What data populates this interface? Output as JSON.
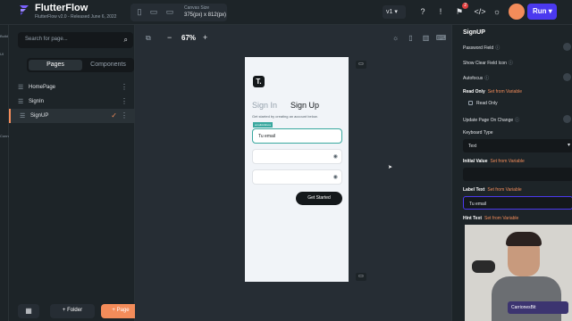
{
  "topbar": {
    "app_name": "FlutterFlow",
    "app_version": "FlutterFlow v2.0 - Released June 6, 2022",
    "canvas_size_label": "Canvas Size",
    "canvas_size_value": "375(px) x 812(px)",
    "version": "v1",
    "notification_count": "2",
    "run_label": "Run"
  },
  "rail": {
    "labels": [
      "Build",
      "UI",
      "Connect"
    ]
  },
  "pages_panel": {
    "search_placeholder": "Search for page...",
    "tabs": [
      "Pages",
      "Components"
    ],
    "pages": [
      "HomePage",
      "SignIn",
      "SignUP"
    ],
    "folder_label": "Folder",
    "page_label": "Page"
  },
  "canvas": {
    "zoom": "67%"
  },
  "phone": {
    "logo_letter": "T.",
    "tab_signin": "Sign In",
    "tab_signup": "Sign Up",
    "subtitle": "Get started by creating an account below.",
    "selected_tag": "emailAddress",
    "email_text": "Tu email",
    "button": "Get Started"
  },
  "properties": {
    "title": "SignUP",
    "password_field": "Password Field",
    "show_clear": "Show Clear Field Icon",
    "autofocus": "Autofocus",
    "read_only": "Read Only",
    "set_from_variable": "Set from Variable",
    "read_only_checkbox": "Read Only",
    "update_page": "Update Page On Change",
    "keyboard_type": "Keyboard Type",
    "keyboard_value": "Text",
    "initial_value": "Initial Value",
    "label_text": "Label Text",
    "label_value": "Tu email",
    "hint_text": "Hint Text"
  },
  "webcam": {
    "logo_text": "CarrionesBit"
  },
  "colors": {
    "accent": "#f38c5a",
    "primary": "#4b39ef",
    "selection": "#39a89f"
  }
}
